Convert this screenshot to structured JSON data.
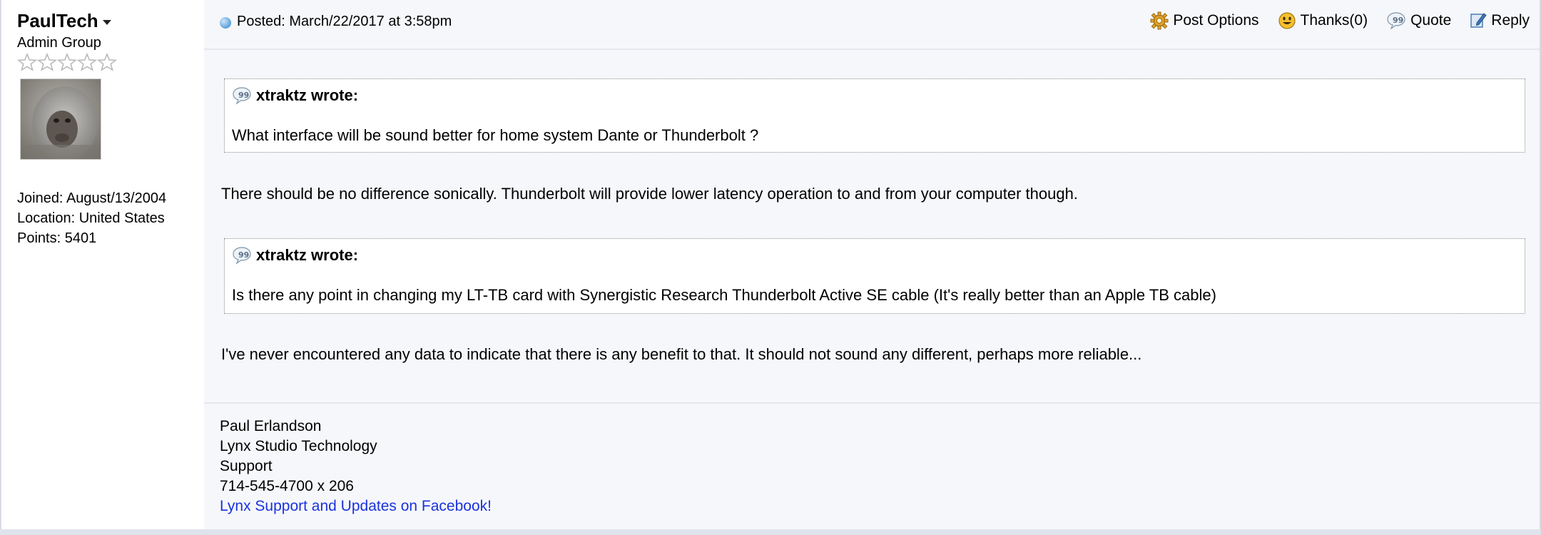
{
  "user": {
    "name": "PaulTech",
    "group": "Admin Group",
    "joined": "Joined: August/13/2004",
    "location": "Location: United States",
    "points": "Points: 5401"
  },
  "post": {
    "posted": "Posted: March/22/2017 at 3:58pm",
    "actions": {
      "post_options": "Post Options",
      "thanks": "Thanks(0)",
      "quote": "Quote",
      "reply": "Reply"
    },
    "quotes": [
      {
        "author": "xtraktz wrote:",
        "text": "What interface will be sound better for home system Dante or Thunderbolt ?"
      },
      {
        "author": "xtraktz wrote:",
        "text": "Is there any point in changing my LT-TB card with Synergistic Research Thunderbolt Active SE cable (It's really better than an Apple TB cable)"
      }
    ],
    "replies": [
      "There should be no difference sonically. Thunderbolt will provide lower latency operation to and from your computer though.",
      "I've never encountered any data to indicate that there is any benefit to that. It should not sound any different, perhaps more reliable..."
    ]
  },
  "signature": {
    "name": "Paul Erlandson",
    "company": "Lynx Studio Technology",
    "dept": "Support",
    "phone": "714-545-4700 x 206",
    "link": "Lynx Support and Updates on Facebook!"
  },
  "colors": {
    "link": "#1a33dd",
    "main_background": "#f6f7fa",
    "quote_border": "#8a8a8a",
    "star_outline": "#b9b9b9"
  },
  "icons": {
    "user_menu": "chevron-down-icon",
    "rank": "star-icon",
    "posted": "blue-dot-icon",
    "post_options": "gear-icon",
    "thanks": "smiley-icon",
    "quote": "speech-bubble-icon",
    "reply": "pencil-reply-icon"
  }
}
